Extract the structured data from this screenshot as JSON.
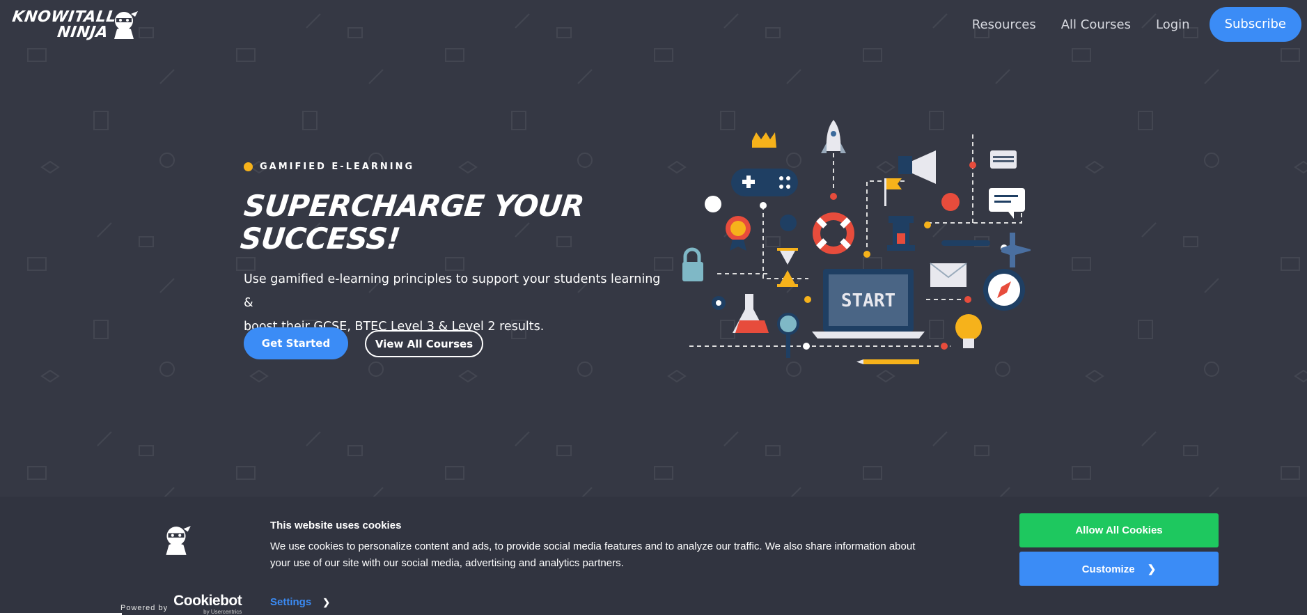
{
  "header": {
    "logo_line1": "KNOWITALL",
    "logo_line2": "NINJA",
    "nav": [
      "Resources",
      "All Courses",
      "Login"
    ],
    "subscribe_label": "Subscribe"
  },
  "hero": {
    "eyebrow": "GAMIFIED E-LEARNING",
    "title_line1": "SUPERCHARGE YOUR",
    "title_line2": "SUCCESS!",
    "text_line1": "Use gamified e-learning principles to support your students learning &",
    "text_line2": "boost their GCSE, BTEC Level 3 & Level 2 results.",
    "btn_primary": "Get Started",
    "btn_secondary": "View All Courses",
    "illustration_label": "START"
  },
  "cookie": {
    "title": "This website uses cookies",
    "text_line1": "We use cookies to personalize content and ads, to provide social media features and to analyze our traffic. We also share information about",
    "text_line2": "your use of our site with our social media, advertising and analytics partners.",
    "powered_by": "Powered by",
    "cookiebot": "Cookiebot",
    "usercentrics": "by Usercentrics",
    "settings_label": "Settings",
    "allow_label": "Allow All Cookies",
    "customize_label": "Customize"
  },
  "colors": {
    "background": "#353844",
    "accent_blue": "#3b8cf6",
    "accent_yellow": "#f6b21b",
    "allow_green": "#1ec85f"
  }
}
